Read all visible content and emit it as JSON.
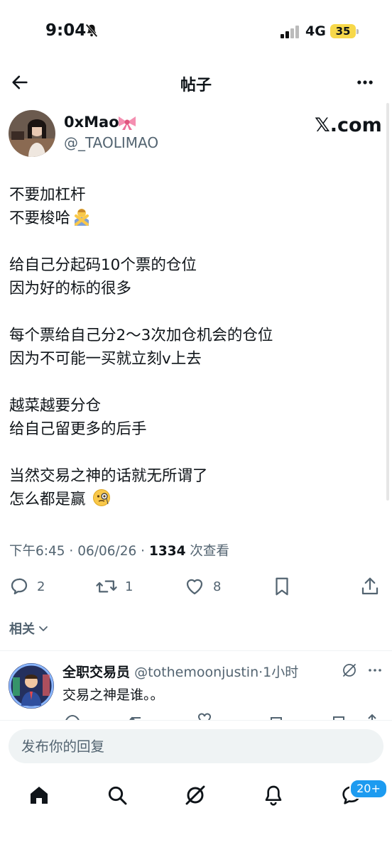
{
  "status_bar": {
    "time": "9:04",
    "network": "4G",
    "battery": "35"
  },
  "header": {
    "title": "帖子"
  },
  "author": {
    "name": "0xMao",
    "handle": "@_TAOLIMAO",
    "source": "𝕏.com"
  },
  "tweet": {
    "lines": [
      "不要加杠杆",
      "不要梭哈",
      "",
      "给自己分起码10个票的仓位",
      "因为好的标的很多",
      "",
      "每个票给自己分2～3次加仓机会的仓位",
      "因为不可能一买就立刻v上去",
      "",
      "越菜越要分仓",
      "给自己留更多的后手",
      "",
      "当然交易之神的话就无所谓了",
      "怎么都是赢"
    ],
    "time": "下午6:45",
    "date": "06/06/26",
    "views": "1334",
    "views_label": "次查看"
  },
  "actions": {
    "replies": "2",
    "retweets": "1",
    "likes": "8"
  },
  "related": {
    "label": "相关"
  },
  "reply": {
    "name": "全职交易员",
    "handle": "@tothemoonjustin",
    "time": "1小时",
    "text": "交易之神是谁。。"
  },
  "compose": {
    "placeholder": "发布你的回复"
  },
  "tabbar": {
    "messages_badge": "20+"
  },
  "colors": {
    "accent": "#1d9bf0",
    "text": "#0f1419",
    "muted": "#536471"
  }
}
